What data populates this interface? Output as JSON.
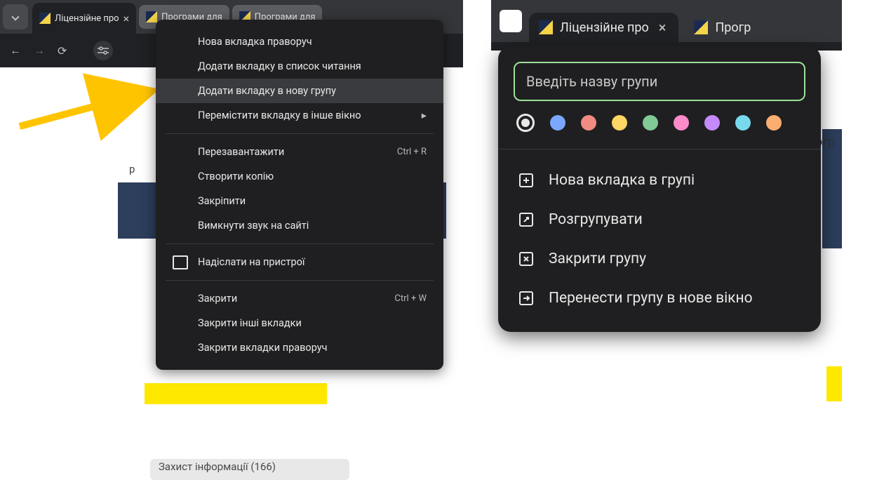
{
  "left": {
    "tabs": [
      {
        "title": "Ліцензійне про"
      },
      {
        "title": "Програми для"
      },
      {
        "title": "Програми для"
      }
    ],
    "page_scrap_top": "р",
    "page_scrap_bottom": "Захист інформації (166)",
    "context_menu": {
      "items": [
        {
          "label": "Нова вкладка праворуч"
        },
        {
          "label": "Додати вкладку в список читання"
        },
        {
          "label": "Додати вкладку в нову групу",
          "hover": true
        },
        {
          "label": "Перемістити вкладку в інше вікно",
          "submenu": true
        }
      ],
      "items2": [
        {
          "label": "Перезавантажити",
          "shortcut": "Ctrl + R"
        },
        {
          "label": "Створити копію"
        },
        {
          "label": "Закріпити"
        },
        {
          "label": "Вимкнути звук на сайті"
        }
      ],
      "items3": [
        {
          "label": "Надіслати на пристрої",
          "icon": true
        }
      ],
      "items4": [
        {
          "label": "Закрити",
          "shortcut": "Ctrl + W"
        },
        {
          "label": "Закрити інші вкладки"
        },
        {
          "label": "Закрити вкладки праворуч"
        }
      ]
    }
  },
  "right": {
    "tabs": [
      {
        "title": "Ліцензійне про"
      },
      {
        "title": "Прогр"
      }
    ],
    "page_text": "огр",
    "popup": {
      "placeholder": "Введіть назву групи",
      "colors": [
        "#e8e8e8",
        "#7aa8ff",
        "#f28b82",
        "#fdd663",
        "#81c995",
        "#ff8bcb",
        "#c58af9",
        "#78d9ec",
        "#fcad70"
      ],
      "items": [
        {
          "label": "Нова вкладка в групі",
          "icon": "new-tab"
        },
        {
          "label": "Розгрупувати",
          "icon": "ungroup"
        },
        {
          "label": "Закрити групу",
          "icon": "close-group"
        },
        {
          "label": "Перенести групу в нове вікно",
          "icon": "move-window"
        }
      ]
    }
  }
}
